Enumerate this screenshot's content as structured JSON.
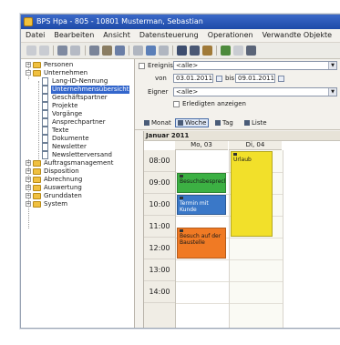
{
  "window": {
    "title": "BPS Hpa - 805 - 10801 Musterman, Sebastian"
  },
  "menu": [
    "Datei",
    "Bearbeiten",
    "Ansicht",
    "Datensteuerung",
    "Operationen",
    "Verwandte Objekte"
  ],
  "tree": {
    "items": [
      {
        "label": "Personen",
        "expanded": false
      },
      {
        "label": "Unternehmen",
        "expanded": true
      },
      {
        "label": "Lang-ID-Nennung"
      },
      {
        "label": "Unternehmensübersicht",
        "selected": true
      },
      {
        "label": "Geschäftspartner"
      },
      {
        "label": "Projekte"
      },
      {
        "label": "Vorgänge"
      },
      {
        "label": "Ansprechpartner"
      },
      {
        "label": "Texte"
      },
      {
        "label": "Dokumente"
      },
      {
        "label": "Newsletter"
      },
      {
        "label": "Newsletterversand"
      },
      {
        "label": "Auftragsmanagement",
        "expanded": false
      },
      {
        "label": "Disposition",
        "expanded": false
      },
      {
        "label": "Abrechnung",
        "expanded": false
      },
      {
        "label": "Auswertung",
        "expanded": false
      },
      {
        "label": "Grunddaten",
        "expanded": false
      },
      {
        "label": "System",
        "expanded": false
      }
    ]
  },
  "filter": {
    "event_label": "Ereignis",
    "event_value": "<alle>",
    "from_label": "von",
    "from_value": "03.01.2011",
    "to_label": "bis",
    "to_value": "09.01.2011",
    "signee_label": "Eigner",
    "signee_value": "<alle>",
    "show_done_label": "Erledigten anzeigen"
  },
  "viewbar": {
    "items": [
      "Monat",
      "Woche",
      "Tag",
      "Liste"
    ],
    "active": "Woche"
  },
  "calendar": {
    "month_label": "Januar 2011",
    "days": [
      "Mo, 03",
      "Di, 04"
    ],
    "hours": [
      "08:00",
      "09:00",
      "10:00",
      "11:00",
      "12:00",
      "13:00",
      "14:00"
    ],
    "appointments": [
      {
        "day": 0,
        "start": 9.0,
        "end": 10.0,
        "text": "Besuchsbesprechung",
        "color": "#3cb043"
      },
      {
        "day": 0,
        "start": 10.0,
        "end": 11.0,
        "text": "Termin mit Kunde",
        "color": "#3a78c8"
      },
      {
        "day": 0,
        "start": 11.5,
        "end": 13.0,
        "text": "Besuch auf der Baustelle",
        "color": "#f07a24"
      },
      {
        "day": 1,
        "start": 8.0,
        "end": 12.0,
        "text": "Urlaub",
        "color": "#f2e02a"
      }
    ]
  }
}
